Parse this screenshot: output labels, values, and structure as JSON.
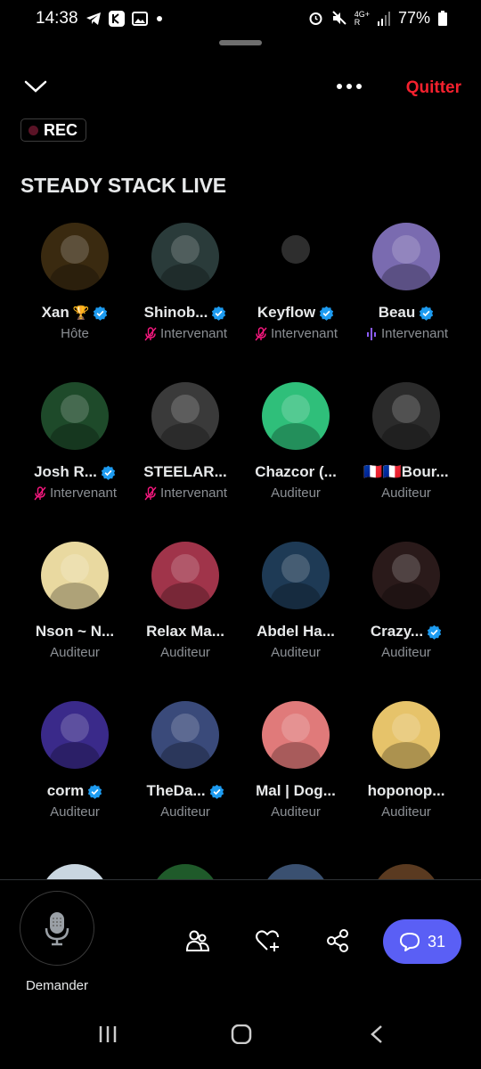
{
  "status_bar": {
    "time": "14:38",
    "battery": "77%",
    "network": "4G+",
    "signal_label": "R"
  },
  "header": {
    "quit_label": "Quitter",
    "rec_label": "REC",
    "space_title": "STEADY STACK LIVE"
  },
  "participants": [
    {
      "name": "Xan",
      "role": "Hôte",
      "badge": "trophy",
      "trophy": "🏆",
      "verified": true,
      "role_icon": "none",
      "avatar_color": "#3a2a10"
    },
    {
      "name": "Shinob...",
      "role": "Intervenant",
      "verified": true,
      "role_icon": "mic-off",
      "avatar_color": "#2a3b3a"
    },
    {
      "name": "Keyflow",
      "role": "Intervenant",
      "verified": true,
      "role_icon": "mic-off",
      "avatar_color": "#000000"
    },
    {
      "name": "Beau",
      "role": "Intervenant",
      "verified": true,
      "role_icon": "speaking",
      "avatar_color": "#7a6bb0"
    },
    {
      "name": "Josh R...",
      "role": "Intervenant",
      "verified": true,
      "role_icon": "mic-off",
      "avatar_color": "#1e4a2a"
    },
    {
      "name": "STEELAR...",
      "role": "Intervenant",
      "verified": false,
      "role_icon": "mic-off",
      "avatar_color": "#3a3a3a"
    },
    {
      "name": "Chazcor (...",
      "role": "Auditeur",
      "verified": false,
      "role_icon": "none",
      "avatar_color": "#2fbf7a"
    },
    {
      "name": "🇫🇷🇫🇷Bour...",
      "role": "Auditeur",
      "verified": false,
      "role_icon": "none",
      "avatar_color": "#2b2b2b"
    },
    {
      "name": "Nson ~ N...",
      "role": "Auditeur",
      "verified": false,
      "role_icon": "none",
      "avatar_color": "#e9d9a0"
    },
    {
      "name": "Relax Ma...",
      "role": "Auditeur",
      "verified": false,
      "role_icon": "none",
      "avatar_color": "#a0344a"
    },
    {
      "name": "Abdel Ha...",
      "role": "Auditeur",
      "verified": false,
      "role_icon": "none",
      "avatar_color": "#1e3a55"
    },
    {
      "name": "Crazy...",
      "role": "Auditeur",
      "verified": true,
      "role_icon": "none",
      "avatar_color": "#2a1a1a"
    },
    {
      "name": "corm",
      "role": "Auditeur",
      "verified": true,
      "role_icon": "none",
      "avatar_color": "#3a2a8a"
    },
    {
      "name": "TheDa...",
      "role": "Auditeur",
      "verified": true,
      "role_icon": "none",
      "avatar_color": "#3a4a7a"
    },
    {
      "name": "Mal | Dog...",
      "role": "Auditeur",
      "verified": false,
      "role_icon": "none",
      "avatar_color": "#e07a7a"
    },
    {
      "name": "hoponop...",
      "role": "Auditeur",
      "verified": false,
      "role_icon": "none",
      "avatar_color": "#e6c36a"
    }
  ],
  "bottom_bar": {
    "mic_label": "Demander",
    "comment_count": "31"
  },
  "colors": {
    "accent_red": "#f4212e",
    "verified_blue": "#1d9bf0",
    "mic_off_pink": "#f91880",
    "speaking_purple": "#8b5cf6",
    "comments_bg": "#5a5ff5"
  }
}
